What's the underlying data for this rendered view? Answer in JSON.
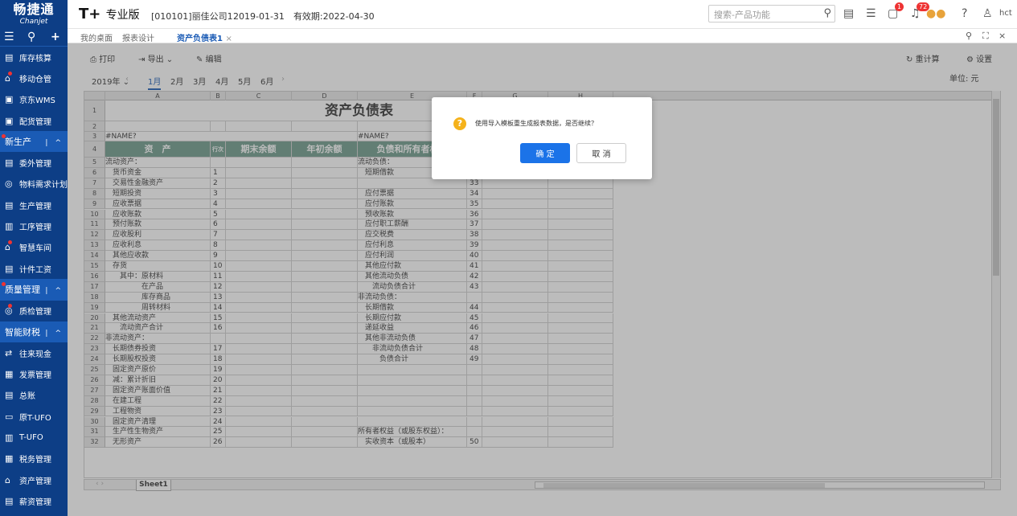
{
  "header": {
    "logo_cn": "畅捷通",
    "logo_en": "Chanjet",
    "brand": "T+",
    "brand_edition": "专业版",
    "company": "[010101]丽佳公司1",
    "date": "2019-01-31",
    "validity": "有效期:2022-04-30",
    "search_placeholder": "搜索-产品功能",
    "message_badge": "1",
    "notification_badge": "72",
    "user": "hct"
  },
  "sidebar": {
    "items": [
      {
        "label": "库存核算",
        "dot": false,
        "section": false
      },
      {
        "label": "移动仓管",
        "dot": true,
        "section": false
      },
      {
        "label": "京东WMS",
        "dot": false,
        "section": false
      },
      {
        "label": "配货管理",
        "dot": false,
        "section": false
      },
      {
        "label": "新生产",
        "dot": true,
        "section": true
      },
      {
        "label": "委外管理",
        "dot": false,
        "section": false
      },
      {
        "label": "物料需求计划",
        "dot": false,
        "section": false
      },
      {
        "label": "生产管理",
        "dot": false,
        "section": false
      },
      {
        "label": "工序管理",
        "dot": false,
        "section": false
      },
      {
        "label": "智慧车间",
        "dot": true,
        "section": false
      },
      {
        "label": "计件工资",
        "dot": false,
        "section": false
      },
      {
        "label": "质量管理",
        "dot": true,
        "section": true
      },
      {
        "label": "质检管理",
        "dot": true,
        "section": false
      },
      {
        "label": "智能财税",
        "dot": false,
        "section": true
      },
      {
        "label": "往来现金",
        "dot": false,
        "section": false
      },
      {
        "label": "发票管理",
        "dot": false,
        "section": false
      },
      {
        "label": "总账",
        "dot": false,
        "section": false
      },
      {
        "label": "原T-UFO",
        "dot": false,
        "section": false
      },
      {
        "label": "T-UFO",
        "dot": false,
        "section": false
      },
      {
        "label": "税务管理",
        "dot": false,
        "section": false
      },
      {
        "label": "资产管理",
        "dot": false,
        "section": false
      },
      {
        "label": "薪资管理",
        "dot": false,
        "section": false
      }
    ]
  },
  "tabs": [
    "我的桌面",
    "报表设计",
    "资产负债表1"
  ],
  "toolbar": {
    "print": "打印",
    "export": "导出",
    "edit": "编辑",
    "recalc": "重计算",
    "settings": "设置"
  },
  "period": {
    "year": "2019年",
    "months": [
      "1月",
      "2月",
      "3月",
      "4月",
      "5月",
      "6月"
    ],
    "unit": "单位: 元"
  },
  "sheet": {
    "columns": [
      "A",
      "B",
      "C",
      "D",
      "E",
      "F",
      "G",
      "H"
    ],
    "title": "资产负债表",
    "name_error": "#NAME?",
    "header": {
      "asset": "资　产",
      "line_no": "行次",
      "end_balance": "期末余额",
      "begin_balance": "年初余额",
      "liability": "负债和所有者权益"
    },
    "rows": [
      {
        "a": "流动资产：",
        "b": "",
        "e": "流动负债：",
        "f": ""
      },
      {
        "a": "　货币资金",
        "b": "1",
        "e": "　短期借款",
        "f": "32"
      },
      {
        "a": "　交易性金融资产",
        "b": "2",
        "e": "",
        "f": "33"
      },
      {
        "a": "　短期投资",
        "b": "3",
        "e": "　应付票据",
        "f": "34"
      },
      {
        "a": "　应收票据",
        "b": "4",
        "e": "　应付账款",
        "f": "35"
      },
      {
        "a": "　应收账款",
        "b": "5",
        "e": "　预收账款",
        "f": "36"
      },
      {
        "a": "　预付账款",
        "b": "6",
        "e": "　应付职工薪酬",
        "f": "37"
      },
      {
        "a": "　应收股利",
        "b": "7",
        "e": "　应交税费",
        "f": "38"
      },
      {
        "a": "　应收利息",
        "b": "8",
        "e": "　应付利息",
        "f": "39"
      },
      {
        "a": "　其他应收款",
        "b": "9",
        "e": "　应付利润",
        "f": "40"
      },
      {
        "a": "　存货",
        "b": "10",
        "e": "　其他应付款",
        "f": "41"
      },
      {
        "a": "　　其中：原材料",
        "b": "11",
        "e": "　其他流动负债",
        "f": "42"
      },
      {
        "a": "　　　　　在产品",
        "b": "12",
        "e": "　　流动负债合计",
        "f": "43"
      },
      {
        "a": "　　　　　库存商品",
        "b": "13",
        "e": "非流动负债：",
        "f": ""
      },
      {
        "a": "　　　　　周转材料",
        "b": "14",
        "e": "　长期借款",
        "f": "44"
      },
      {
        "a": "　其他流动资产",
        "b": "15",
        "e": "　长期应付款",
        "f": "45"
      },
      {
        "a": "　　流动资产合计",
        "b": "16",
        "e": "　递延收益",
        "f": "46"
      },
      {
        "a": "非流动资产：",
        "b": "",
        "e": "　其他非流动负债",
        "f": "47"
      },
      {
        "a": "　长期债券投资",
        "b": "17",
        "e": "　　非流动负债合计",
        "f": "48"
      },
      {
        "a": "　长期股权投资",
        "b": "18",
        "e": "　　　负债合计",
        "f": "49"
      },
      {
        "a": "　固定资产原价",
        "b": "19",
        "e": "",
        "f": ""
      },
      {
        "a": "　减：累计折旧",
        "b": "20",
        "e": "",
        "f": ""
      },
      {
        "a": "　固定资产账面价值",
        "b": "21",
        "e": "",
        "f": ""
      },
      {
        "a": "　在建工程",
        "b": "22",
        "e": "",
        "f": ""
      },
      {
        "a": "　工程物资",
        "b": "23",
        "e": "",
        "f": ""
      },
      {
        "a": "　固定资产清理",
        "b": "24",
        "e": "",
        "f": ""
      },
      {
        "a": "　生产性生物资产",
        "b": "25",
        "e": "所有者权益（或股东权益）：",
        "f": ""
      },
      {
        "a": "　无形资产",
        "b": "26",
        "e": "　实收资本（或股本）",
        "f": "50"
      }
    ],
    "sheet_tab": "Sheet1"
  },
  "dialog": {
    "message": "使用导入模板重生成报表数据，是否继续？",
    "ok": "确 定",
    "cancel": "取 消",
    "warn_color": "#f5b21b",
    "ok_color": "#1b73e8"
  }
}
